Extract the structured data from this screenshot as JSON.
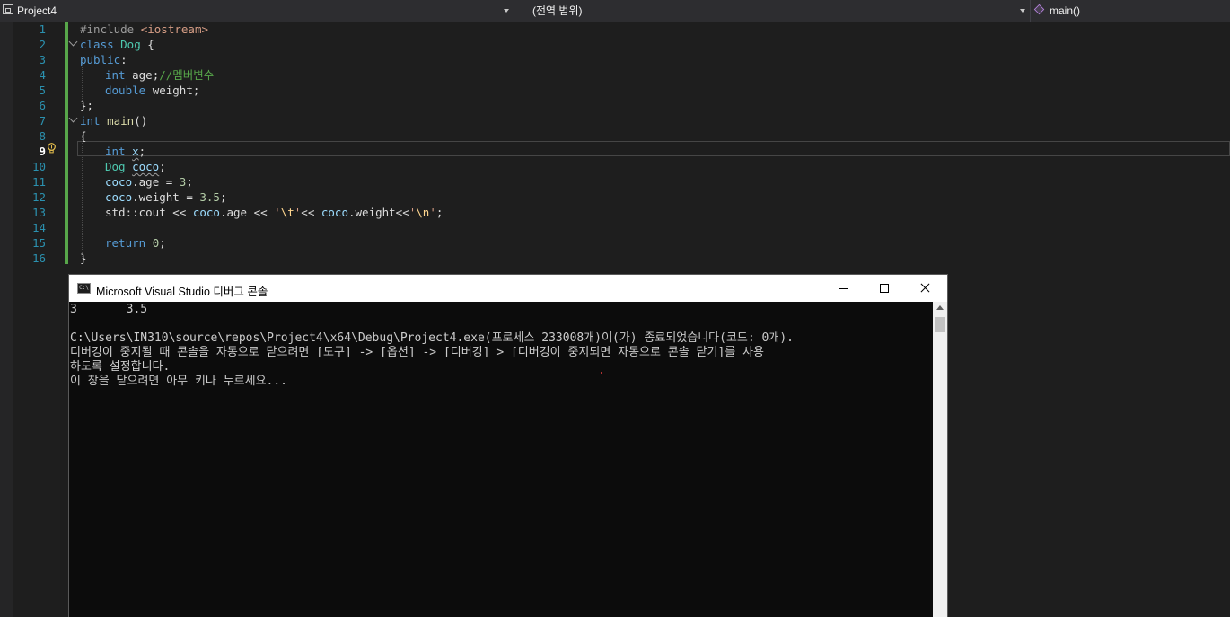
{
  "navbar": {
    "project": "Project4",
    "scope": "(전역 범위)",
    "member": "main()"
  },
  "editor": {
    "current_line": 9,
    "line_numbers": [
      "1",
      "2",
      "3",
      "4",
      "5",
      "6",
      "7",
      "8",
      "9",
      "10",
      "11",
      "12",
      "13",
      "14",
      "15",
      "16"
    ]
  },
  "code": {
    "l1_directive": "#include ",
    "l1_header": "<iostream>",
    "l2_class_kw": "class ",
    "l2_class_name": "Dog",
    "l2_brace": " {",
    "l3_public": "public",
    "l3_colon": ":",
    "l4_type": "int ",
    "l4_member": "age",
    "l4_semi": ";",
    "l4_comment": "//멤버변수",
    "l5_type": "double ",
    "l5_member": "weight",
    "l5_semi": ";",
    "l6_close": "};",
    "l7_type": "int ",
    "l7_fn": "main",
    "l7_parens": "()",
    "l8_open": "{",
    "l9_type": "int ",
    "l9_var": "x",
    "l9_semi": ";",
    "l10_class": "Dog ",
    "l10_var": "coco",
    "l10_semi": ";",
    "l11_obj": "coco",
    "l11_dot": ".",
    "l11_member": "age",
    "l11_op": " = ",
    "l11_num": "3",
    "l11_semi": ";",
    "l12_obj": "coco",
    "l12_dot": ".",
    "l12_member": "weight",
    "l12_op": " = ",
    "l12_num": "3.5",
    "l12_semi": ";",
    "l13_std": "std::cout << ",
    "l13_obj1": "coco",
    "l13_dot1": ".",
    "l13_member1": "age",
    "l13_op1": " << ",
    "l13_q1a": "'",
    "l13_esc1": "\\t",
    "l13_q1b": "'",
    "l13_op2": "<< ",
    "l13_obj2": "coco",
    "l13_dot2": ".",
    "l13_member2": "weight",
    "l13_op3": "<<",
    "l13_q2a": "'",
    "l13_esc2": "\\n",
    "l13_q2b": "'",
    "l13_semi": ";",
    "l15_return": "return ",
    "l15_num": "0",
    "l15_semi": ";",
    "l16_close": "}"
  },
  "console": {
    "title": "Microsoft Visual Studio 디버그 콘솔",
    "icon_text": "C:\\",
    "lines": [
      "3       3.5",
      "",
      "C:\\Users\\IN310\\source\\repos\\Project4\\x64\\Debug\\Project4.exe(프로세스 233008개)이(가) 종료되었습니다(코드: 0개).",
      "디버깅이 중지될 때 콘솔을 자동으로 닫으려면 [도구] -> [옵션] -> [디버깅] > [디버깅이 중지되면 자동으로 콘솔 닫기]를 사용",
      "하도록 설정합니다.",
      "이 창을 닫으려면 아무 키나 누르세요..."
    ]
  },
  "colors": {
    "editor_bg": "#1e1e1e",
    "keyword": "#569cd6",
    "class": "#4ec9b0",
    "comment": "#57a64a",
    "line_number": "#2b91af",
    "console_bg": "#0c0c0c",
    "console_text": "#cccccc"
  },
  "icons": {
    "project": "project-icon",
    "member": "cube-icon",
    "lightbulb": "lightbulb-icon",
    "console": "console-app-icon"
  }
}
